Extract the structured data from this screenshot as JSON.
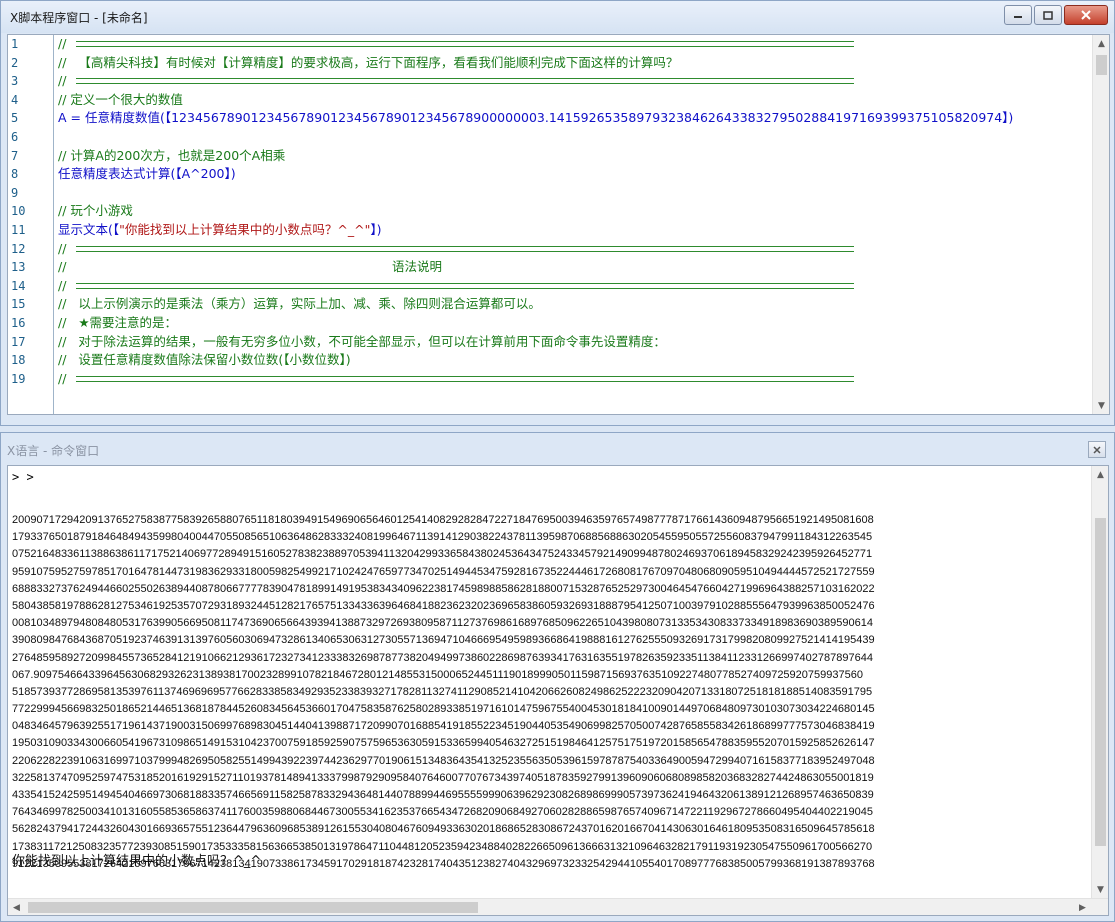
{
  "editor": {
    "title": "X脚本程序窗口 - [未命名]",
    "line_numbers": [
      "1",
      "2",
      "3",
      "4",
      "5",
      "6",
      "7",
      "8",
      "9",
      "10",
      "11",
      "12",
      "13",
      "14",
      "15",
      "16",
      "17",
      "18",
      "19"
    ],
    "lines": [
      {
        "type": "sep",
        "text": "//"
      },
      {
        "type": "comment",
        "text": "//   【高精尖科技】有时候对【计算精度】的要求极高，运行下面程序，看看我们能顺利完成下面这样的计算吗？"
      },
      {
        "type": "sep",
        "text": "//"
      },
      {
        "type": "comment",
        "text": "// 定义一个很大的数值"
      },
      {
        "type": "code",
        "text": "A = 任意精度数值(【12345678901234567890123456789012345678900000003.14159265358979323846264338327950288419716939937510582097­4】)"
      },
      {
        "type": "blank",
        "text": ""
      },
      {
        "type": "comment",
        "text": "// 计算A的200次方，也就是200个A相乘"
      },
      {
        "type": "code",
        "text": "任意精度表达式计算(【A^200】)"
      },
      {
        "type": "blank",
        "text": ""
      },
      {
        "type": "comment",
        "text": "// 玩个小游戏"
      },
      {
        "type": "code_str",
        "text": "显示文本(【",
        "str": "\"你能找到以上计算结果中的小数点吗？^_^\"",
        "tail": "】)"
      },
      {
        "type": "sep",
        "text": "//"
      },
      {
        "type": "heading",
        "text": "//",
        "center": "语法说明"
      },
      {
        "type": "sep",
        "text": "//"
      },
      {
        "type": "comment",
        "text": "//   以上示例演示的是乘法（乘方）运算，实际上加、减、乘、除四则混合运算都可以。"
      },
      {
        "type": "comment",
        "text": "//   ★需要注意的是："
      },
      {
        "type": "comment",
        "text": "//   对于除法运算的结果，一般有无穷多位小数，不可能全部显示，但可以在计算前用下面命令事先设置精度："
      },
      {
        "type": "comment",
        "text": "//   设置任意精度数值除法保留小数位数(【小数位数】)"
      },
      {
        "type": "sep",
        "text": "//"
      }
    ]
  },
  "command": {
    "title": "X语言 - 命令窗口",
    "prompt": "> >",
    "result_lines": [
      "200907172942091376527583877583926588076511818039491549690656460125414082928284722718476950039463597657498777871766143609487956651921495081608",
      "179337650187918464849435998040044705508565106364862833324081996467113914129038224378113959870688568863020545595055725560837947991184312263545",
      "075216483361138863861171752140697728949151605278382388970539411320429933658438024536434752433457921490994878024693706189458329242395926452771",
      "959107595275978517016478144731983629331800598254992171024247659773470251494453475928167352244461726808176709704806809059510494444572521727559",
      "688833273762494466025502638944087806677778390478189914919538343409622381745989885862818800715328765252973004645476604271996964388257103162022",
      "580438581978862812753461925357072931893244512821765751334336396468418823623202369658386059326931888795412507100397910288555647939963850052476",
      "008103489794808480531763990566950811747369065664393941388732972693809587112737698616897685096226510439808073133534308337334918983690389590614",
      "390809847684368705192374639131397605603069473286134065306312730557136947104666954959893668641988816127625550932691731799820809927521414195439",
      "276485958927209984557365284121910662129361723273412333832698787738204949973860228698763934176316355197826359233511384112331266997402787897644",
      "067.9097546643396456306829326231389381700232899107821846728012148553150006524451119018999050115987156937635109227480778527409725920759937560",
      "518573937728695813539761137469696957766283385834929352338393271782811327411290852141042066260824986252223209042071331807251818188514083591795",
      "772299945669832501865214465136818784452608345645366017047583587625802893385197161014759675540045301818410090144970684809730103073034224680145",
      "048346457963925517196143719003150699768983045144041398871720990701688541918552234519044053549069982570500742876585583426186899777573046838419",
      "195031090334300660541967310986514915310423700759185925907575965363059153365994054632725151984641257517519720158565478835955207015925852626147",
      "220622822391063169971037999482695058255149943922397442362977019061513483643541325235563505396159787875403364900594729940716158377183952497048",
      "322581374709525974753185201619291527110193781489413337998792909584076460077076734397405187835927991396090606808985820368328274424863055001819",
      "433541524259514945404669730681883357466569115825878332943648144078899446955559990639629230826898699905739736241946432061389121268957463650839",
      "764346997825003410131605585365863741176003598806844673005534162353766543472682090684927060282886598765740967147221192967278660495404402219045",
      "562824379417244326043016693657551236447963609685389126155304080467609493363020186865283086724370162016670414306301646180953508316509645785618",
      "173831172125083235772393085159017353335815636653850131978647110448120523594234884028226650961366631321096463282179119319230547550961700566270",
      "912213539553817264210976631796714238134190733861734591702918187423281740435123827404329697323325429441055401708977768385005799368191387893768"
    ],
    "message": "你能找到以上计算结果中的小数点吗？^_^"
  }
}
